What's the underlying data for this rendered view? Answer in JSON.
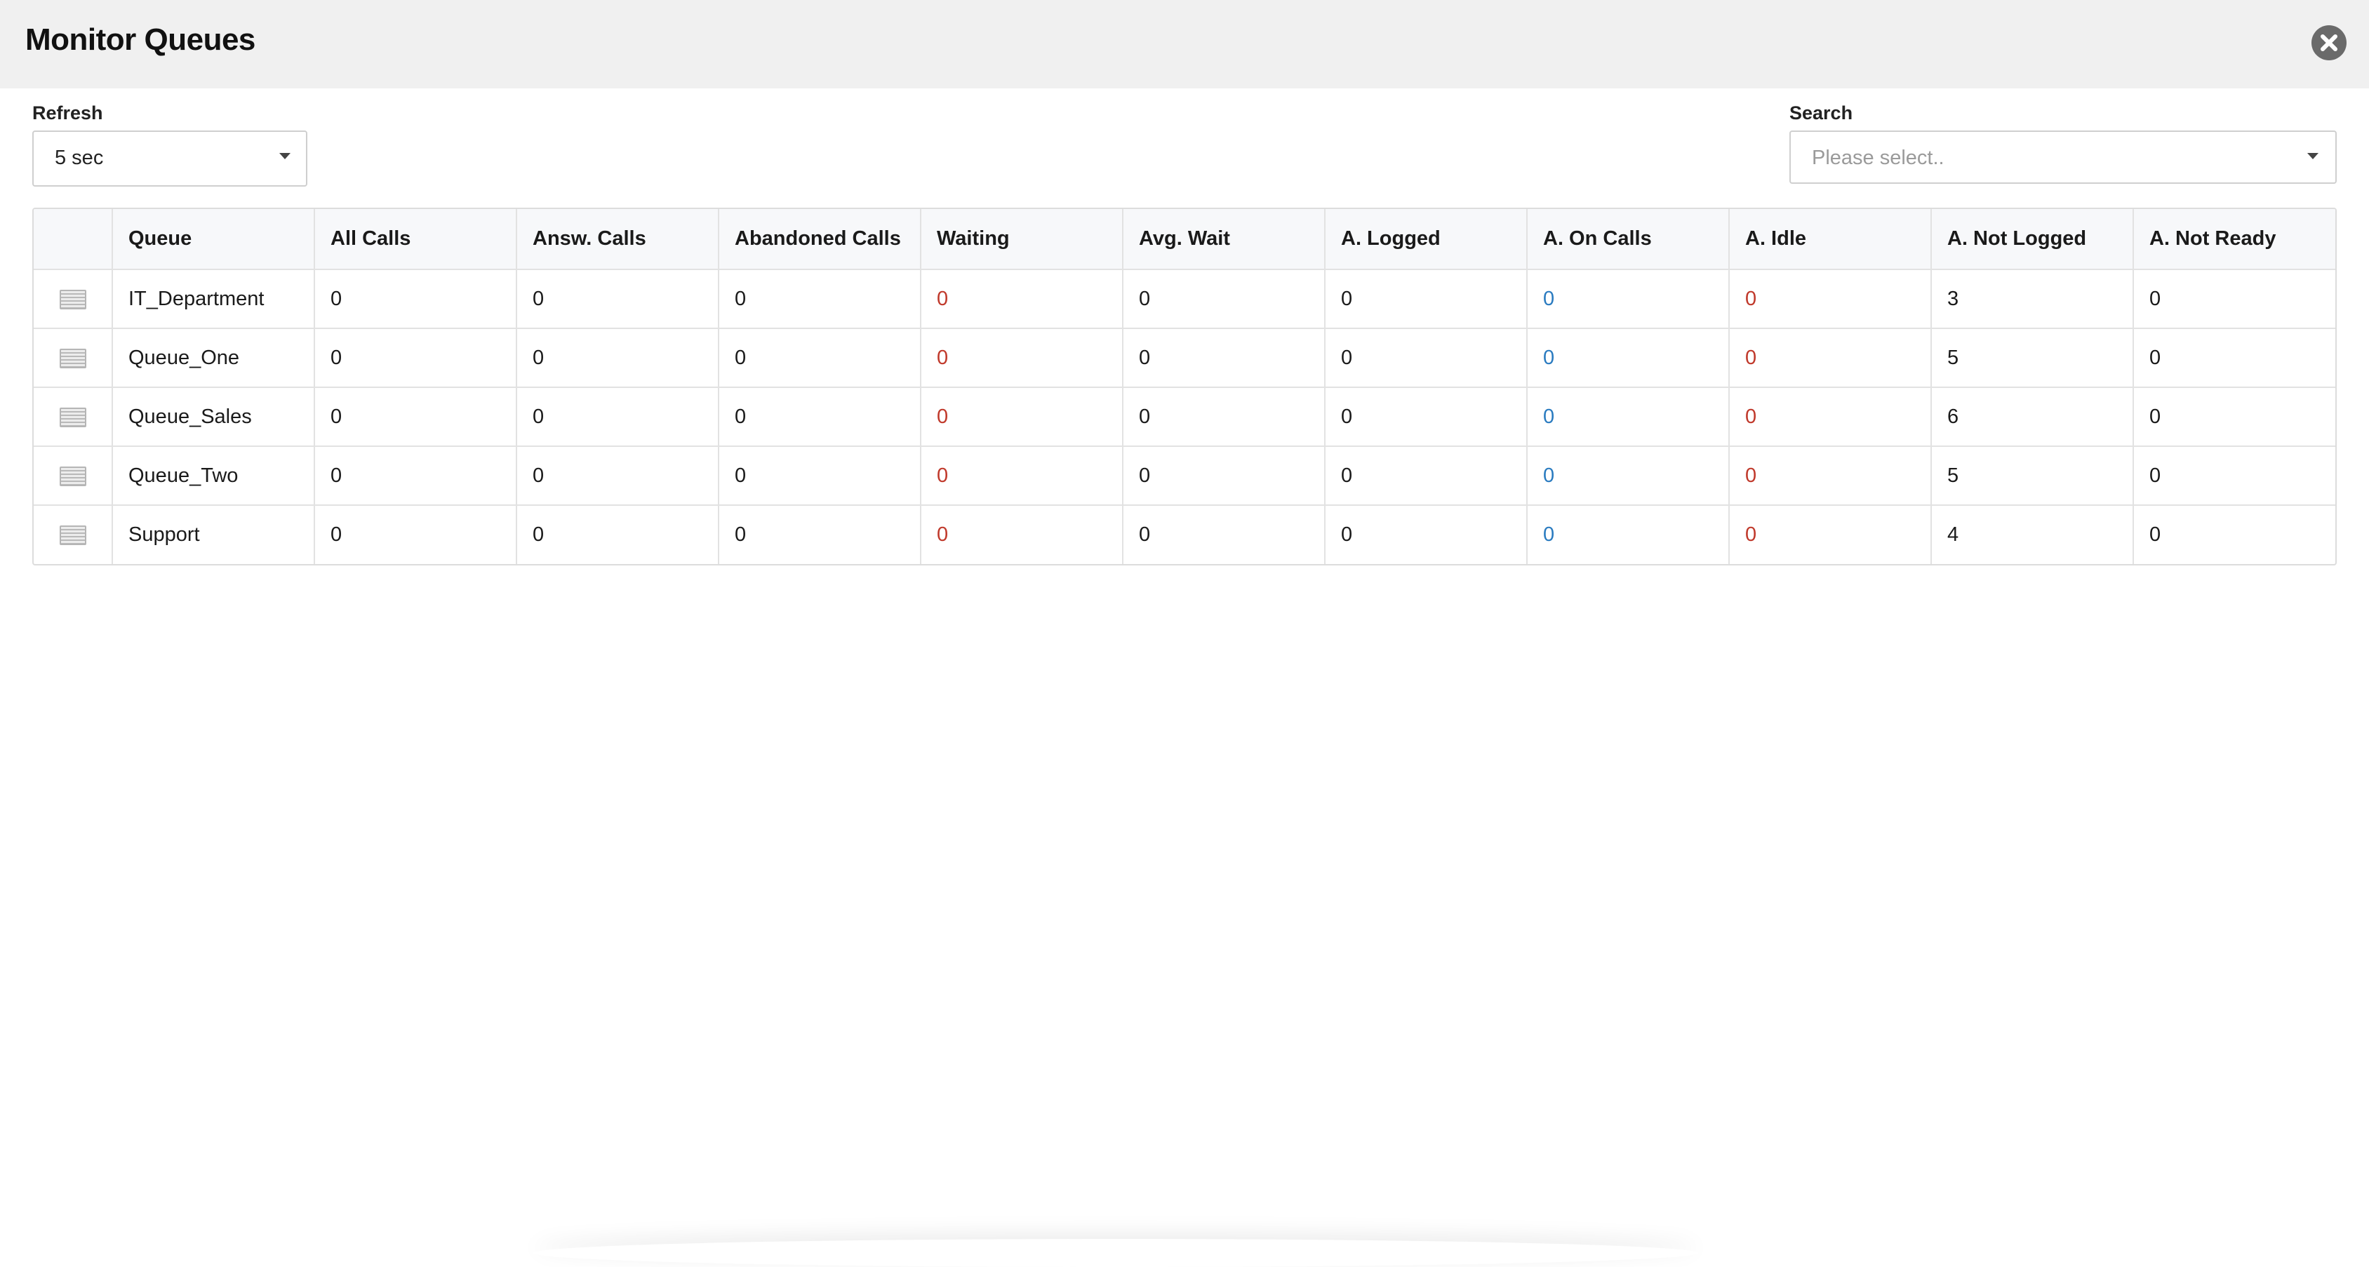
{
  "window": {
    "title": "Monitor Queues"
  },
  "refresh": {
    "label": "Refresh",
    "selected": "5 sec"
  },
  "search": {
    "label": "Search",
    "placeholder": "Please select.."
  },
  "table": {
    "columns": [
      "",
      "Queue",
      "All Calls",
      "Answ. Calls",
      "Abandoned Calls",
      "Waiting",
      "Avg. Wait",
      "A. Logged",
      "A. On Calls",
      "A. Idle",
      "A. Not Logged",
      "A. Not Ready"
    ],
    "rows": [
      {
        "queue": "IT_Department",
        "all_calls": "0",
        "answ_calls": "0",
        "abandoned_calls": "0",
        "waiting": "0",
        "avg_wait": "0",
        "a_logged": "0",
        "a_on_calls": "0",
        "a_idle": "0",
        "a_not_logged": "3",
        "a_not_ready": "0"
      },
      {
        "queue": "Queue_One",
        "all_calls": "0",
        "answ_calls": "0",
        "abandoned_calls": "0",
        "waiting": "0",
        "avg_wait": "0",
        "a_logged": "0",
        "a_on_calls": "0",
        "a_idle": "0",
        "a_not_logged": "5",
        "a_not_ready": "0"
      },
      {
        "queue": "Queue_Sales",
        "all_calls": "0",
        "answ_calls": "0",
        "abandoned_calls": "0",
        "waiting": "0",
        "avg_wait": "0",
        "a_logged": "0",
        "a_on_calls": "0",
        "a_idle": "0",
        "a_not_logged": "6",
        "a_not_ready": "0"
      },
      {
        "queue": "Queue_Two",
        "all_calls": "0",
        "answ_calls": "0",
        "abandoned_calls": "0",
        "waiting": "0",
        "avg_wait": "0",
        "a_logged": "0",
        "a_on_calls": "0",
        "a_idle": "0",
        "a_not_logged": "5",
        "a_not_ready": "0"
      },
      {
        "queue": "Support",
        "all_calls": "0",
        "answ_calls": "0",
        "abandoned_calls": "0",
        "waiting": "0",
        "avg_wait": "0",
        "a_logged": "0",
        "a_on_calls": "0",
        "a_idle": "0",
        "a_not_logged": "4",
        "a_not_ready": "0"
      }
    ]
  },
  "colors": {
    "header_bg": "#f0f0f0",
    "waiting_value": "#c0392b",
    "on_calls_value": "#2a7bc0",
    "idle_value": "#c0392b"
  },
  "icons": {
    "close": "close-circle-icon",
    "row_detail": "list-detail-icon",
    "dropdown": "caret-down-icon"
  }
}
